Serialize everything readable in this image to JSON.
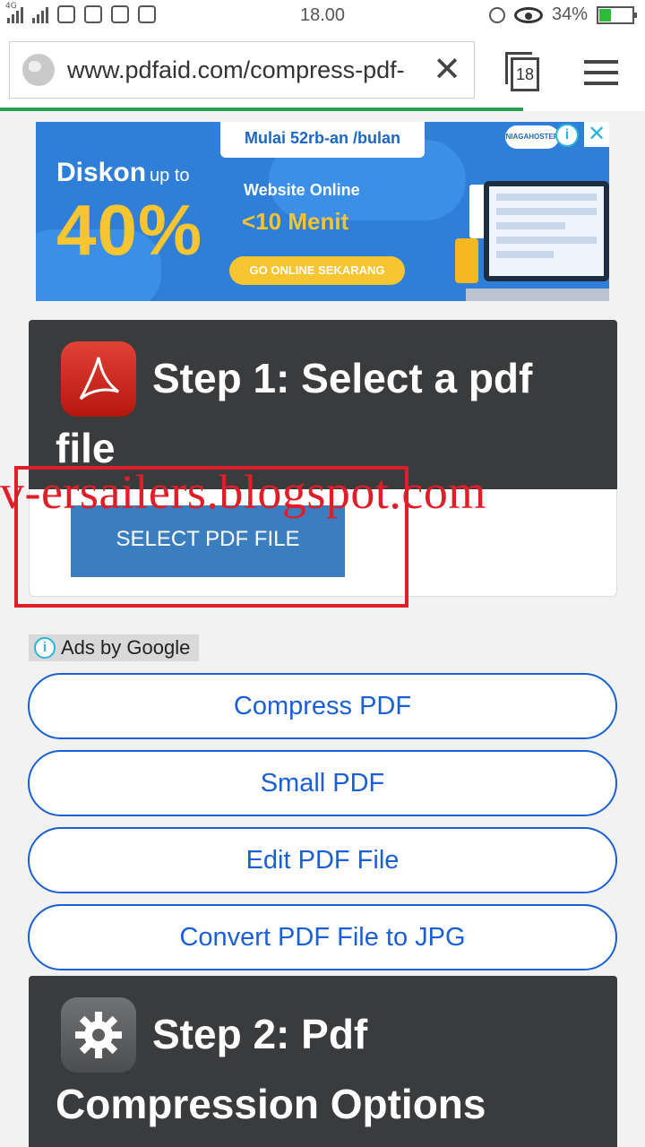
{
  "status_bar": {
    "network": "4G",
    "time": "18.00",
    "battery_percent": "34%",
    "battery_level": 0.34,
    "icons": [
      "signal-icon",
      "signal-icon",
      "instagram-icon",
      "download-icon",
      "blackberry-icon",
      "notification-icon",
      "alarm-icon",
      "eye-icon",
      "battery-charging-icon"
    ]
  },
  "browser": {
    "url": "www.pdfaid.com/compress-pdf-",
    "tab_count": "18",
    "icons": [
      "globe-icon",
      "close-icon",
      "tabs-icon",
      "menu-icon"
    ],
    "progress_accent": "#2aa052"
  },
  "ad_banner": {
    "top_label": "Mulai 52rb-an /bulan",
    "discount_prefix": "Diskon",
    "discount_upto": "up to",
    "discount_value": "40%",
    "headline": "Website Online",
    "subheadline": "<10 Menit",
    "cta": "GO ONLINE SEKARANG",
    "brand": "NIAGAHOSTER",
    "colors": {
      "background": "#2f7fd9",
      "accent": "#f7c531"
    }
  },
  "step1": {
    "title": "Step 1: Select a pdf file",
    "icon": "pdf-icon",
    "button_label": "SELECT PDF FILE",
    "button_color": "#3b7ec0"
  },
  "watermark": "v-ersailers.blogspot.com",
  "ads_by": "Ads by Google",
  "ad_links": [
    {
      "label": "Compress PDF"
    },
    {
      "label": "Small PDF"
    },
    {
      "label": "Edit PDF File"
    },
    {
      "label": "Convert PDF File to JPG"
    }
  ],
  "step2": {
    "title": "Step 2: Pdf Compression Options",
    "icon": "gear-icon"
  },
  "colors": {
    "link": "#1b5fd6",
    "card": "#3a3b3c",
    "annotation": "#e01e2a"
  }
}
